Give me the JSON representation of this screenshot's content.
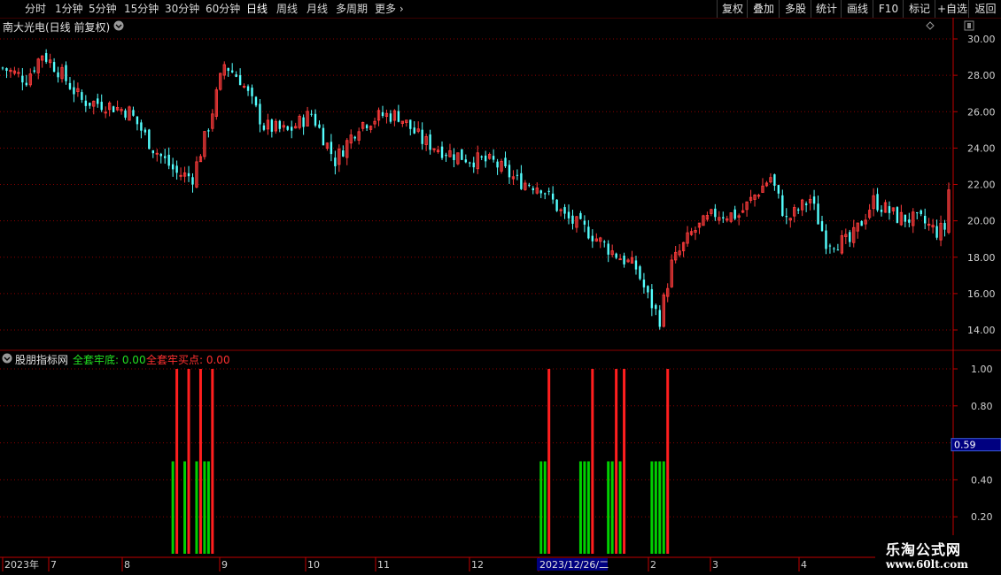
{
  "toolbar": {
    "periods": [
      "分时",
      "1分钟",
      "5分钟",
      "15分钟",
      "30分钟",
      "60分钟",
      "日线",
      "周线",
      "月线",
      "多周期",
      "更多"
    ],
    "active_period": "日线",
    "right_buttons": [
      "复权",
      "叠加",
      "多股",
      "统计",
      "画线",
      "F10",
      "标记",
      "+自选",
      "返回"
    ]
  },
  "main_panel": {
    "title": "南大光电(日线 前复权)",
    "chevron_icon": "chevron-down-icon",
    "pin_icon": "diamond-icon",
    "scroll_icon": "scroll-box-icon"
  },
  "indicator_panel": {
    "name": "股朋指标网",
    "label_green": "全套牢底: 0.00",
    "label_red": "全套牢买点: 0.00",
    "cursor_value": "0.59"
  },
  "x_axis": {
    "labels": [
      "2023年",
      "7",
      "8",
      "9",
      "10",
      "11",
      "12",
      "2023/12/26/二",
      "2",
      "3",
      "4"
    ]
  },
  "watermark": {
    "line1": "乐淘公式网",
    "line2": "www.60lt.com"
  },
  "colors": {
    "up": "#ff3c3c",
    "down": "#54ffff",
    "grid": "#8b0000",
    "axis": "#c00000",
    "green_bar": "#00d000",
    "red_bar": "#ff1e1e"
  },
  "chart_data": [
    {
      "type": "candlestick",
      "title": "南大光电(日线 前复权)",
      "y_ticks": [
        14.0,
        16.0,
        18.0,
        20.0,
        22.0,
        24.0,
        26.0,
        28.0,
        30.0
      ],
      "ylim": [
        13.5,
        30.3
      ],
      "anchors": [
        [
          0,
          28.4
        ],
        [
          6,
          27.8
        ],
        [
          10,
          29.2
        ],
        [
          14,
          28.3
        ],
        [
          20,
          26.6
        ],
        [
          26,
          26.4
        ],
        [
          32,
          26.0
        ],
        [
          38,
          24.0
        ],
        [
          44,
          22.6
        ],
        [
          48,
          22.4
        ],
        [
          52,
          25.2
        ],
        [
          56,
          28.6
        ],
        [
          60,
          27.8
        ],
        [
          66,
          25.2
        ],
        [
          72,
          24.9
        ],
        [
          78,
          25.9
        ],
        [
          84,
          23.3
        ],
        [
          90,
          25.3
        ],
        [
          96,
          25.8
        ],
        [
          100,
          25.8
        ],
        [
          106,
          24.4
        ],
        [
          112,
          23.8
        ],
        [
          118,
          23.4
        ],
        [
          124,
          23.2
        ],
        [
          130,
          22.2
        ],
        [
          136,
          21.9
        ],
        [
          142,
          20.2
        ],
        [
          148,
          19.4
        ],
        [
          154,
          18.3
        ],
        [
          160,
          17.4
        ],
        [
          163,
          15.8
        ],
        [
          166,
          14.6
        ],
        [
          169,
          17.6
        ],
        [
          174,
          19.3
        ],
        [
          180,
          20.4
        ],
        [
          186,
          20.3
        ],
        [
          190,
          21.4
        ],
        [
          194,
          22.4
        ],
        [
          198,
          20.0
        ],
        [
          204,
          21.2
        ],
        [
          208,
          18.9
        ],
        [
          214,
          18.8
        ],
        [
          220,
          21.1
        ],
        [
          226,
          20.2
        ],
        [
          232,
          20.0
        ],
        [
          236,
          19.4
        ],
        [
          238,
          19.6
        ],
        [
          239,
          21.7
        ]
      ],
      "n_bars": 240
    },
    {
      "type": "bar",
      "name": "股朋指标网",
      "y_ticks": [
        0.2,
        0.4,
        0.6,
        0.8,
        1.0
      ],
      "ylim": [
        0.0,
        1.06
      ],
      "series": [
        {
          "name": "全套牢底",
          "value": 0.5,
          "x": [
            43,
            46,
            49,
            51,
            52,
            136,
            137,
            146,
            147,
            148,
            153,
            154,
            156,
            164,
            165,
            166,
            167
          ]
        },
        {
          "name": "全套牢买点",
          "value": 1.0,
          "x": [
            44,
            47,
            50,
            53,
            138,
            149,
            155,
            157,
            168
          ]
        }
      ]
    }
  ]
}
